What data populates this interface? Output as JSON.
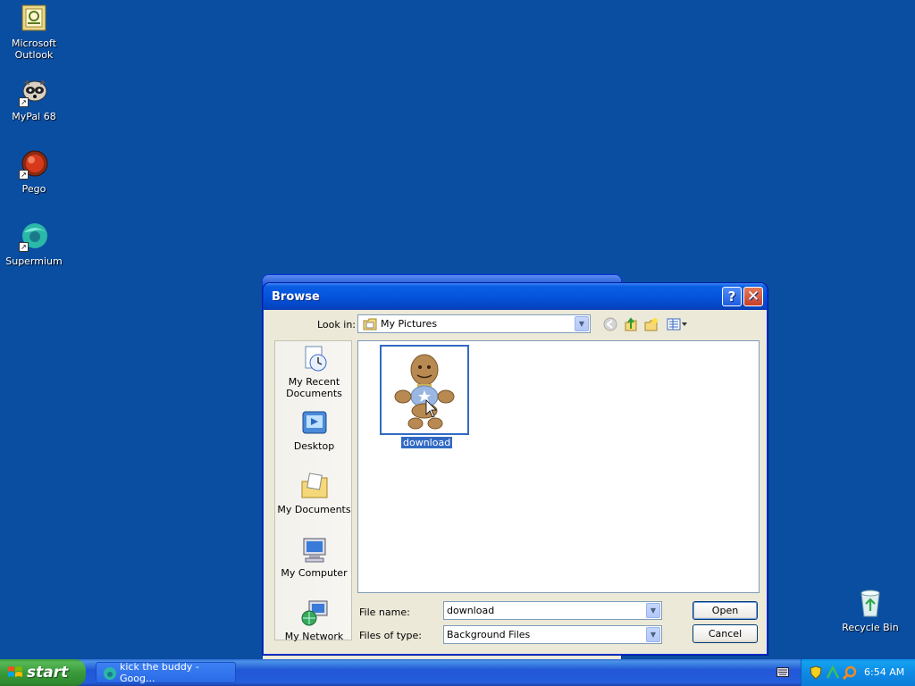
{
  "desktop": {
    "icons": [
      {
        "label_line1": "Microsoft",
        "label_line2": "Outlook",
        "icon": "outlook-icon"
      },
      {
        "label": "MyPal 68",
        "icon": "mypal-icon"
      },
      {
        "label": "Pego",
        "icon": "pego-icon"
      },
      {
        "label": "Supermium",
        "icon": "supermium-icon"
      },
      {
        "label": "Recycle Bin",
        "icon": "recycle-bin-icon"
      }
    ]
  },
  "dialog": {
    "title": "Browse",
    "look_in_label": "Look in:",
    "look_in_value": "My Pictures",
    "places": [
      {
        "line1": "My Recent",
        "line2": "Documents"
      },
      {
        "label": "Desktop"
      },
      {
        "label": "My Documents"
      },
      {
        "label": "My Computer"
      },
      {
        "label": "My Network"
      }
    ],
    "files": [
      {
        "name": "download",
        "selected": true
      }
    ],
    "file_name_label": "File name:",
    "file_name_value": "download",
    "file_type_label": "Files of type:",
    "file_type_value": "Background Files",
    "open_button": "Open",
    "cancel_button": "Cancel"
  },
  "taskbar": {
    "start_label": "start",
    "task_label": "kick the buddy - Goog...",
    "clock": "6:54 AM"
  },
  "colors": {
    "desktop_bg": "#0a4ea2",
    "title_blue": "#0554dc",
    "selection": "#316ac5"
  }
}
